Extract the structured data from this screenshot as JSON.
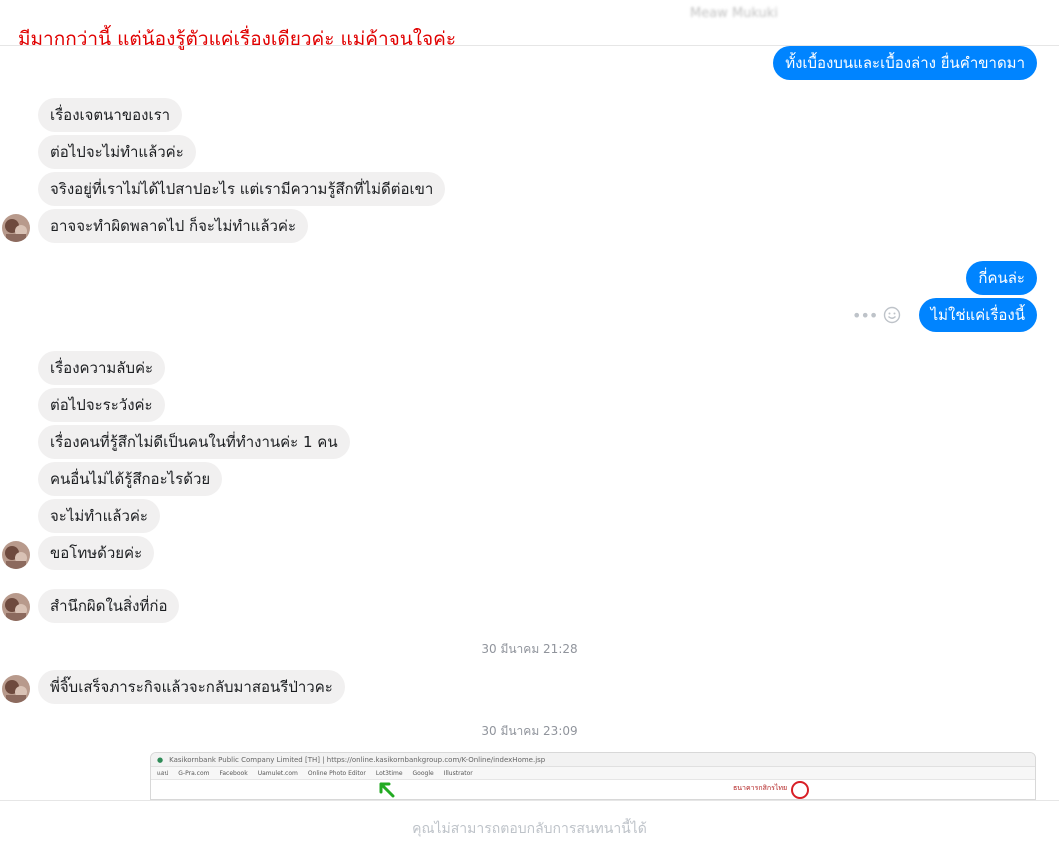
{
  "header": {
    "contact_name": "Meaw Mukuki",
    "overlay_caption": "มีมากกว่านี้ แต่น้องรู้ตัวแค่เรื่องเดียวค่ะ แม่ค้าจนใจค่ะ"
  },
  "messages": [
    {
      "side": "out",
      "text": "ทั้งเบื้องบนและเบื้องล่าง ยื่นคำขาดมา"
    },
    {
      "side": "in",
      "text": "เรื่องเจตนาของเรา"
    },
    {
      "side": "in",
      "text": "ต่อไปจะไม่ทำแล้วค่ะ"
    },
    {
      "side": "in",
      "text": "จริงอยู่ที่เราไม่ได้ไปสาปอะไร แต่เรามีความรู้สึกที่ไม่ดีต่อเขา"
    },
    {
      "side": "in",
      "text": "อาจจะทำผิดพลาดไป ก็จะไม่ทำแล้วค่ะ"
    },
    {
      "side": "out",
      "text": "กี่คนล่ะ"
    },
    {
      "side": "out",
      "text": "ไม่ใช่แค่เรื่องนี้"
    },
    {
      "side": "in",
      "text": "เรื่องความลับค่ะ"
    },
    {
      "side": "in",
      "text": "ต่อไปจะระวังค่ะ"
    },
    {
      "side": "in",
      "text": "เรื่องคนที่รู้สึกไม่ดีเป็นคนในที่ทำงานค่ะ 1 คน"
    },
    {
      "side": "in",
      "text": "คนอื่นไม่ได้รู้สึกอะไรด้วย"
    },
    {
      "side": "in",
      "text": "จะไม่ทำแล้วค่ะ"
    },
    {
      "side": "in",
      "text": "ขอโทษด้วยค่ะ"
    },
    {
      "side": "in",
      "text": "สำนึกผิดในสิ่งที่ก่อ"
    },
    {
      "side": "in",
      "text": "พี่จิ๊บเสร็จภาระกิจแล้วจะกลับมาสอนรีป่าวคะ"
    }
  ],
  "timestamps": [
    "30 มีนาคม 21:28",
    "30 มีนาคม 23:09"
  ],
  "attachment": {
    "url_text": "Kasikornbank Public Company Limited [TH] | https://online.kasikornbankgroup.com/K-Online/indexHome.jsp",
    "bookmarks": [
      "แอป",
      "G-Pra.com",
      "Facebook",
      "Uamulet.com",
      "Online Photo Editor",
      "Lot3time",
      "Google",
      "Illustrator"
    ],
    "bank_name": "ธนาคารกสิกรไทย"
  },
  "footer": {
    "notice": "คุณไม่สามารถตอบกลับการสนทนานี้ได้"
  },
  "colors": {
    "outgoing_bubble": "#0084ff",
    "incoming_bubble": "#f1f0f0",
    "caption_red": "#e00000"
  },
  "icons": [
    "avatar",
    "more-dots-icon",
    "emoji-icon",
    "arrow-icon"
  ]
}
